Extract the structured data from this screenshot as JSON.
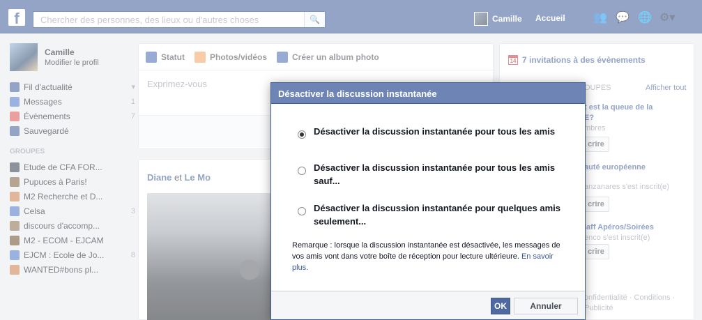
{
  "topbar": {
    "logo": "f",
    "search_placeholder": "Chercher des personnes, des lieux ou d'autres choses",
    "user_name": "Camille",
    "home_label": "Accueil",
    "icons": [
      "friends-icon",
      "messages-icon",
      "globe-icon",
      "settings-icon"
    ]
  },
  "left": {
    "profile_name": "Camille",
    "profile_edit": "Modifier le profil",
    "nav": [
      {
        "label": "Fil d'actualité",
        "count": "▾",
        "color": "#3b5998"
      },
      {
        "label": "Messages",
        "count": "1",
        "color": "#4a74c7"
      },
      {
        "label": "Évènements",
        "count": "7",
        "color": "#d9534f"
      },
      {
        "label": "Sauvegardé",
        "count": "",
        "color": "#3b5998"
      }
    ],
    "groups_heading": "GROUPES",
    "groups": [
      {
        "label": "Etude de CFA FOR...",
        "count": ""
      },
      {
        "label": "Pupuces à Paris!",
        "count": ""
      },
      {
        "label": "M2 Recherche et D...",
        "count": ""
      },
      {
        "label": "Celsa",
        "count": "3"
      },
      {
        "label": "discours d'accomp...",
        "count": ""
      },
      {
        "label": "M2 - ECOM - EJCAM",
        "count": ""
      },
      {
        "label": "EJCM : Ecole de Jo...",
        "count": "8"
      },
      {
        "label": "WANTED#bons pl...",
        "count": ""
      }
    ]
  },
  "composer": {
    "tabs": [
      "Statut",
      "Photos/vidéos",
      "Créer un album photo"
    ],
    "placeholder": "Exprimez-vous"
  },
  "post": {
    "author": "Diane",
    "connector": " et ",
    "other": "Le Mo"
  },
  "right": {
    "invitations": "7 invitations à des évènements",
    "cal_day": "14",
    "groups_head": "OUPES",
    "show_all": "Afficher tout",
    "items": [
      {
        "line1": "t est la queue de la",
        "line2": "E?",
        "line3": "mbres",
        "button": "crire"
      },
      {
        "line1": "auté européenne",
        "line2": "",
        "line3": "",
        "button": ""
      },
      {
        "line1": "",
        "line2": "",
        "line3": "anzanares s'est inscrit(e)",
        "button": "crire"
      },
      {
        "line1": "laff Apéros/Soirées",
        "line2": "",
        "line3": "enco s'est inscrit(e)",
        "button": "crire"
      }
    ],
    "footer": "onfidentialité · Conditions · Publicité"
  },
  "dialog": {
    "title": "Désactiver la discussion instantanée",
    "options": [
      {
        "label": "Désactiver la discussion instantanée pour tous les amis",
        "checked": true
      },
      {
        "label": "Désactiver la discussion instantanée pour tous les amis sauf...",
        "checked": false
      },
      {
        "label": "Désactiver la discussion instantanée pour quelques amis seulement...",
        "checked": false
      }
    ],
    "note": "Remarque : lorsque la discussion instantanée est désactivée, les messages de vos amis vont dans votre boîte de réception pour lecture ultérieure.",
    "note_link": "En savoir plus.",
    "ok": "OK",
    "cancel": "Annuler"
  }
}
